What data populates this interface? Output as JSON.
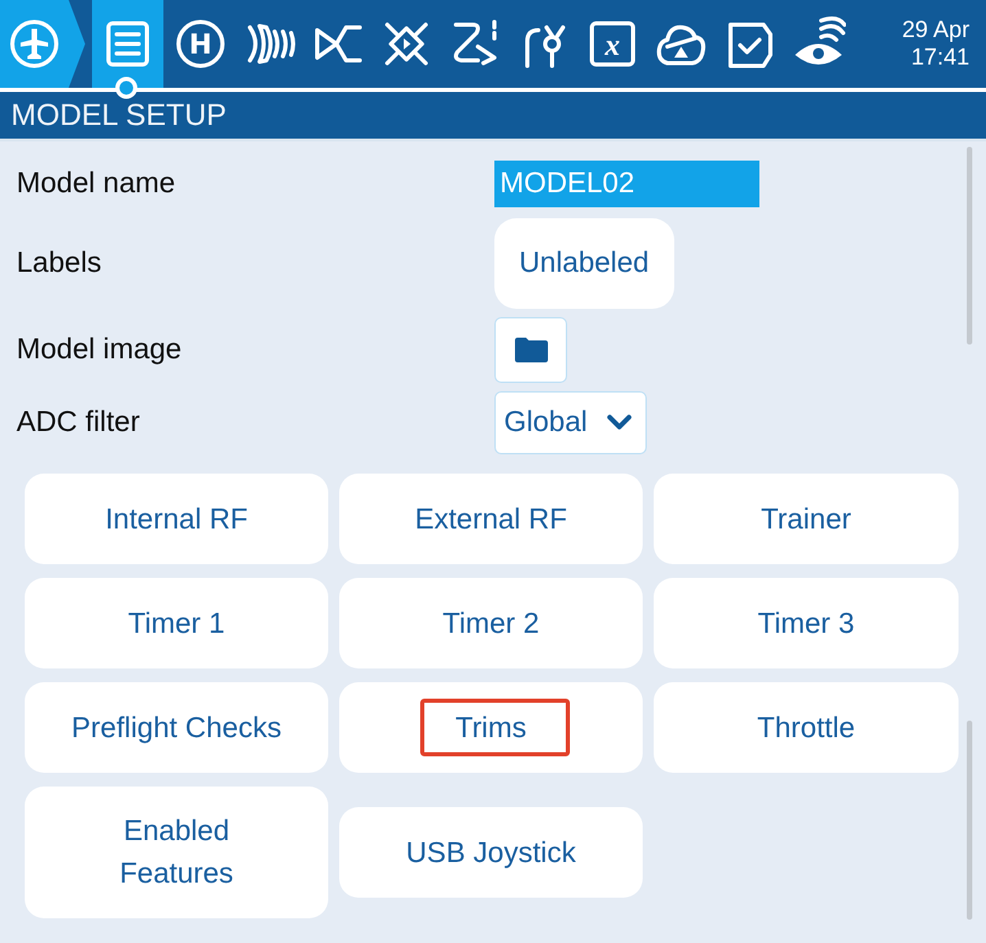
{
  "top_bar": {
    "tabs": [
      {
        "selected": true
      },
      {
        "glyph": "H",
        "selected": false
      },
      {
        "selected": false
      },
      {
        "selected": false
      },
      {
        "selected": false
      },
      {
        "selected": false
      },
      {
        "selected": false
      },
      {
        "glyph": "x",
        "selected": false
      },
      {
        "selected": false
      },
      {
        "selected": false
      },
      {
        "selected": false
      }
    ],
    "date": "29 Apr",
    "time": "17:41"
  },
  "page_title": "MODEL SETUP",
  "fields": [
    {
      "label": "Model name",
      "kind": "text",
      "value": "MODEL02"
    },
    {
      "label": "Labels",
      "kind": "button",
      "value": "Unlabeled"
    },
    {
      "label": "Model image",
      "kind": "folder"
    },
    {
      "label": "ADC filter",
      "kind": "dropdown",
      "value": "Global"
    }
  ],
  "buttons": [
    {
      "label": "Internal RF",
      "highlighted": false,
      "wrap": false
    },
    {
      "label": "External RF",
      "highlighted": false,
      "wrap": false
    },
    {
      "label": "Trainer",
      "highlighted": false,
      "wrap": false
    },
    {
      "label": "Timer 1",
      "highlighted": false,
      "wrap": false
    },
    {
      "label": "Timer 2",
      "highlighted": false,
      "wrap": false
    },
    {
      "label": "Timer 3",
      "highlighted": false,
      "wrap": false
    },
    {
      "label": "Preflight Checks",
      "highlighted": false,
      "wrap": false
    },
    {
      "label": "Trims",
      "highlighted": true,
      "wrap": false
    },
    {
      "label": "Throttle",
      "highlighted": false,
      "wrap": false
    },
    {
      "label": "Enabled Features",
      "highlighted": false,
      "wrap": true
    },
    {
      "label": "USB Joystick",
      "highlighted": false,
      "wrap": false
    }
  ]
}
